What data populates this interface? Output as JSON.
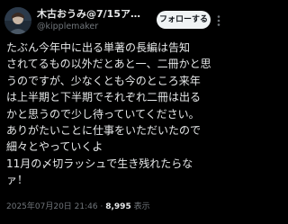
{
  "post": {
    "author": {
      "display_name": "木古おうみ@7/15ア…",
      "handle": "@kipplemaker",
      "avatar_icon": "user-avatar-icon"
    },
    "follow_label": "フォローする",
    "more_icon": "more-dots-icon",
    "lines": [
      "たぶん今年中に出る単著の長編は告知",
      "されてるもの以外だとあと一、二冊かと思",
      "うのですが、少なくとも今のところ来年",
      "は上半期と下半期でそれぞれ二冊は出る",
      "かと思うので少し待っていてください。",
      "ありがたいことに仕事をいただいたので",
      "細々とやっていくよ",
      "11月の〆切ラッシュで生き残れたらな",
      "ァ！"
    ],
    "timestamp": "2025年07月20日 21:46",
    "separator": "·",
    "view_count": "8,995",
    "view_label": "表示"
  },
  "colors": {
    "background": "#000000",
    "text": "#e7e9ea",
    "secondary_text": "#71767b",
    "follow_button_bg": "#eff3f4",
    "follow_button_text": "#0f1419"
  }
}
